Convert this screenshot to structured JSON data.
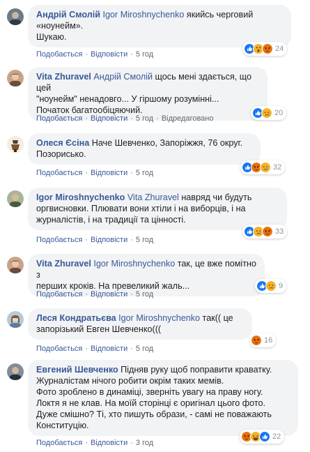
{
  "colors": {
    "link": "#385898",
    "bubble": "#f2f3f5",
    "meta": "#606770"
  },
  "labels": {
    "like": "Подобається",
    "reply": "Відповісти",
    "edited": "Відредаговано"
  },
  "comments": [
    {
      "author": "Андрій Смолій",
      "mention": "Igor Miroshnychenko",
      "line1": " якийсь черговий",
      "lines": [
        "«ноунейм».",
        "Шукаю."
      ],
      "time": "5 год",
      "reactions": [
        "like",
        "wow",
        "angry"
      ],
      "count": "24"
    },
    {
      "author": "Vita Zhuravel",
      "mention": "Андрій Смолій",
      "line1": " щось мені здається, що цей",
      "lines": [
        "\"ноунейм\" ненадовго... У гіршому розумінні...",
        "Початок багатообіцяючий."
      ],
      "time": "5 год",
      "edited": true,
      "reactions": [
        "like",
        "sad"
      ],
      "count": "20"
    },
    {
      "author": "Олеся Єсіна",
      "mention": "",
      "line1": "Наче Шевченко, Запоріжжя, 76 округ.",
      "lines": [
        "Позорисько."
      ],
      "time": "5 год",
      "reactions": [
        "like",
        "angry",
        "sad"
      ],
      "count": "32"
    },
    {
      "author": "Igor Miroshnychenko",
      "mention": "Vita Zhuravel",
      "line1": " навряд чи будуть",
      "lines": [
        "оргвисновки. Плювати вони хтіли і на виборців, і на",
        "журналістів, і на традиції та цінності."
      ],
      "time": "5 год",
      "reactions": [
        "like",
        "sad",
        "angry"
      ],
      "count": "33"
    },
    {
      "author": "Vita Zhuravel",
      "mention": "Igor Miroshnychenko",
      "line1": " так, це вже помітно з",
      "lines": [
        "перших кроків. На превеликий жаль..."
      ],
      "time": "5 год",
      "reactions": [
        "like",
        "sad"
      ],
      "count": "9"
    },
    {
      "author": "Леся Кондратьєва",
      "mention": "Igor Miroshnychenko",
      "line1": " так(( це",
      "lines": [
        "запорізький Евген Шевченко((("
      ],
      "time": "5 год",
      "reactions": [
        "angry"
      ],
      "count": "16"
    },
    {
      "author": "Евгений Шевченко",
      "mention": "",
      "line1": " Підняв руку щоб поправити краватку.",
      "lines": [
        "Журналістам нічого робити окрім таких мемів.",
        "Фото зроблено в динаміці, зверніть увагу на праву ногу.",
        "Локтя я не клав. На моїй сторінці є оригінал цього фото.",
        "Дуже смішно? Ті, хто пишуть образи, - самі не поважають",
        "Конституцію."
      ],
      "time": "3 год",
      "reactions": [
        "angry",
        "haha",
        "like"
      ],
      "count": "22"
    }
  ]
}
